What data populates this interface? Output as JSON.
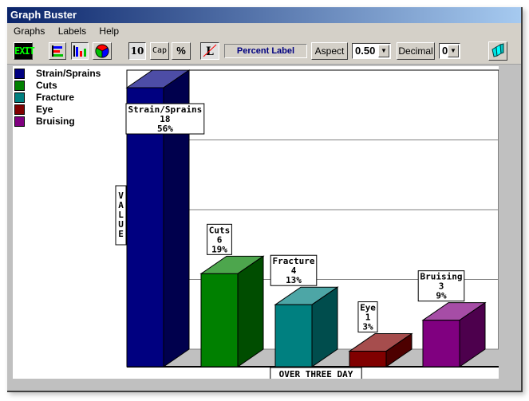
{
  "window": {
    "title": "Graph Buster"
  },
  "menu": {
    "items": [
      "Graphs",
      "Labels",
      "Help"
    ]
  },
  "toolbar": {
    "exit_label": "EXIT",
    "ten_label": "10",
    "cap_label": "Cap",
    "percent_label": "%",
    "label_toggle": "L",
    "label_mode_field": "Percent Label",
    "aspect_label": "Aspect",
    "aspect_value": "0.50",
    "decimal_label": "Decimal",
    "decimal_value": "0",
    "icons": [
      "exit-icon",
      "horizontal-bar-chart-icon",
      "vertical-bar-chart-icon",
      "pie-chart-icon",
      "label-off-icon",
      "logo-icon"
    ]
  },
  "colors": {
    "Strain/Sprains": "#000080",
    "Cuts": "#008000",
    "Fracture": "#008080",
    "Eye": "#800000",
    "Bruising": "#800080"
  },
  "chart_data": {
    "type": "bar",
    "title": "",
    "xlabel": "OVER THREE DAY",
    "ylabel": "VALUE",
    "categories": [
      "Strain/Sprains",
      "Cuts",
      "Fracture",
      "Eye",
      "Bruising"
    ],
    "values": [
      18,
      6,
      4,
      1,
      3
    ],
    "percents": [
      "56%",
      "19%",
      "13%",
      "3%",
      "9%"
    ],
    "ylim": [
      0,
      18
    ],
    "grid": true,
    "legend": "top-left",
    "legend_entries": [
      "Strain/Sprains",
      "Cuts",
      "Fracture",
      "Eye",
      "Bruising"
    ]
  }
}
